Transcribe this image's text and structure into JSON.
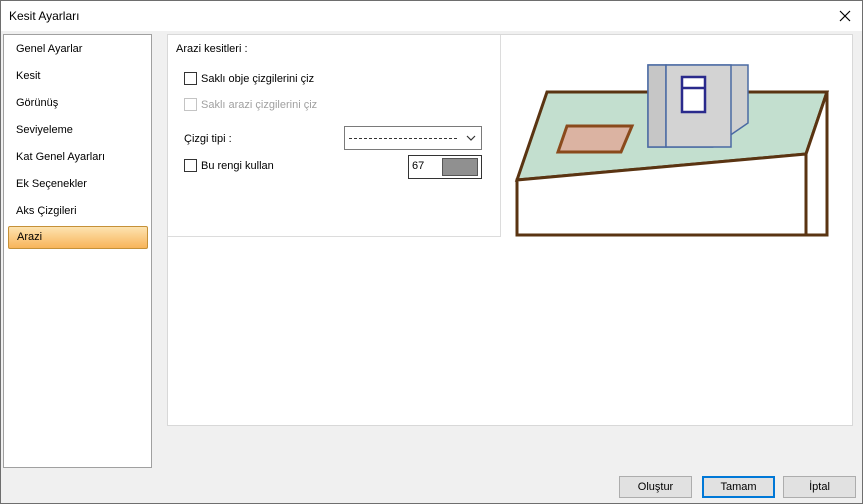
{
  "window": {
    "title": "Kesit Ayarları"
  },
  "nav": {
    "items": [
      {
        "label": "Genel Ayarlar"
      },
      {
        "label": "Kesit"
      },
      {
        "label": "Görünüş"
      },
      {
        "label": "Seviyeleme"
      },
      {
        "label": "Kat Genel Ayarları"
      },
      {
        "label": "Ek Seçenekler"
      },
      {
        "label": "Aks Çizgileri"
      },
      {
        "label": "Arazi"
      }
    ],
    "selected": "Arazi"
  },
  "terrain": {
    "group_title": "Arazi kesitleri :",
    "hidden_objects_label": "Saklı obje çizgilerini çiz",
    "hidden_terrain_label": "Saklı arazi çizgilerini çiz",
    "line_type_label": "Çizgi tipi :",
    "use_color_label": "Bu rengi kullan",
    "color_value": "67",
    "color_swatch": "#909090"
  },
  "footer": {
    "create_label": "Oluştur",
    "ok_label": "Tamam",
    "cancel_label": "İptal"
  }
}
